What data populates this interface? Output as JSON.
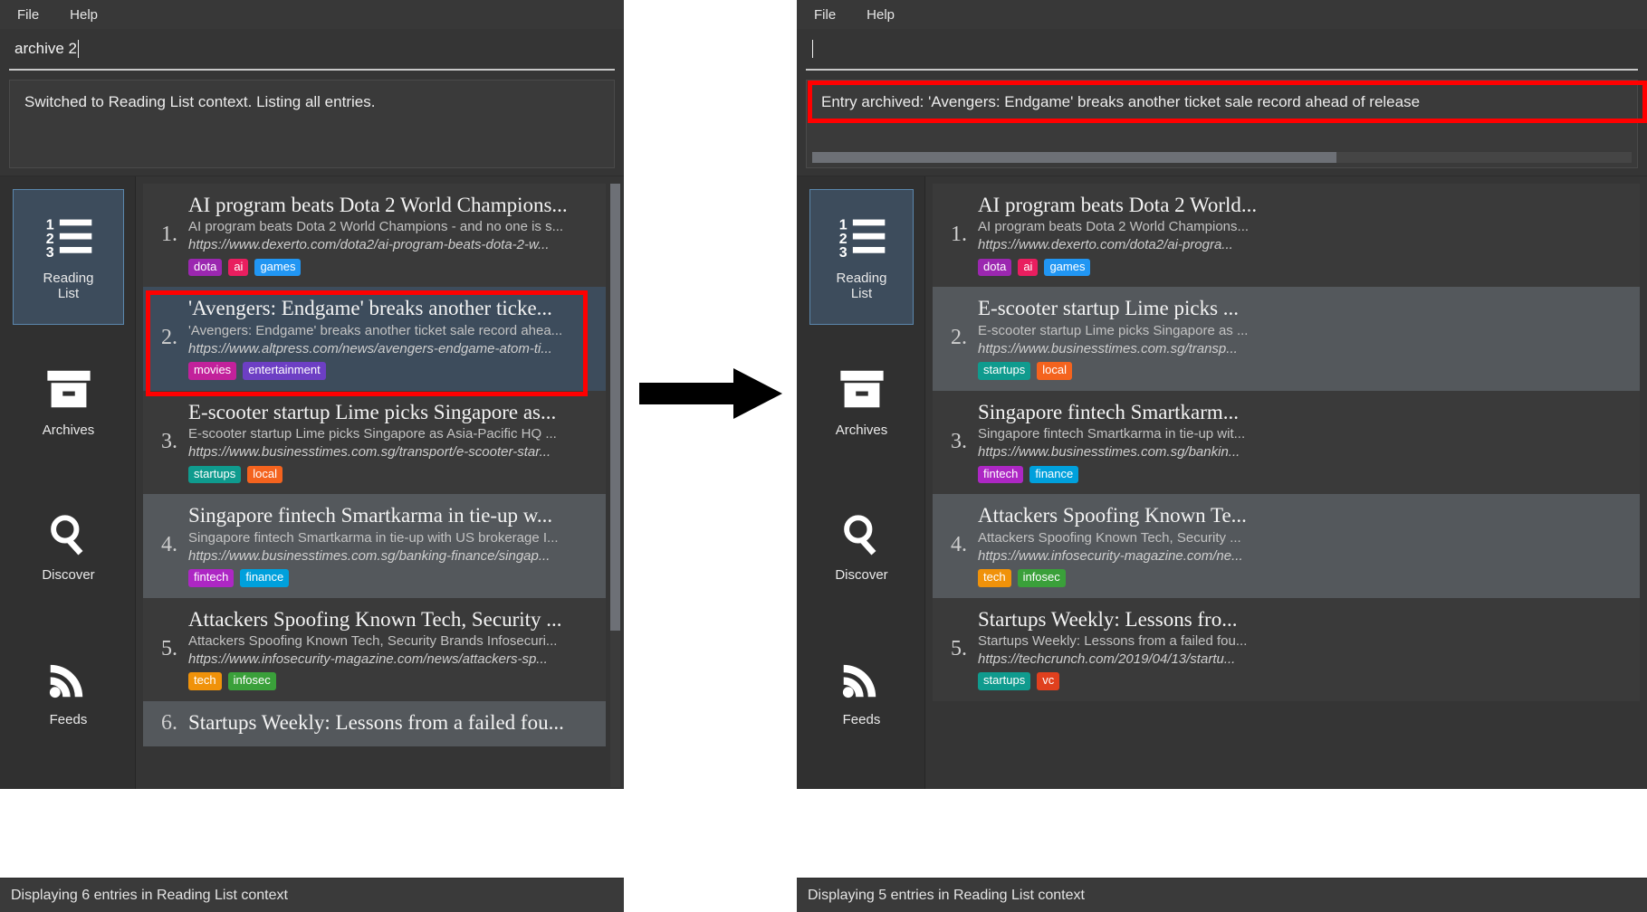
{
  "accent": {
    "highlight_red": "#ff0000",
    "selected_entry_bg": "#3d4c5c",
    "sidebar_active_border": "#5b87ad"
  },
  "menu": {
    "file": "File",
    "help": "Help"
  },
  "left": {
    "command_value": "archive 2",
    "output_message": "Switched to Reading List context. Listing all entries.",
    "status": "Displaying 6 entries in Reading List context",
    "sidebar": [
      {
        "label": "Reading\nList",
        "icon": "numbered-list-icon",
        "active": true
      },
      {
        "label": "Archives",
        "icon": "archive-box-icon",
        "active": false
      },
      {
        "label": "Discover",
        "icon": "magnifier-icon",
        "active": false
      },
      {
        "label": "Feeds",
        "icon": "rss-icon",
        "active": false
      }
    ],
    "entries": [
      {
        "num": "1.",
        "title": "AI program beats Dota 2 World Champions...",
        "desc": "AI program beats Dota 2 World Champions - and no one is s...",
        "url": "https://www.dexerto.com/dota2/ai-program-beats-dota-2-w...",
        "tags": [
          {
            "label": "dota",
            "color": "#9b27b0"
          },
          {
            "label": "ai",
            "color": "#e91e5f"
          },
          {
            "label": "games",
            "color": "#2196f3"
          }
        ],
        "selected": false,
        "alt": false
      },
      {
        "num": "2.",
        "title": "'Avengers: Endgame' breaks another ticke...",
        "desc": "'Avengers: Endgame' breaks another ticket sale record ahea...",
        "url": "https://www.altpress.com/news/avengers-endgame-atom-ti...",
        "tags": [
          {
            "label": "movies",
            "color": "#c2219b"
          },
          {
            "label": "entertainment",
            "color": "#6d3fc4"
          }
        ],
        "selected": true,
        "alt": false
      },
      {
        "num": "3.",
        "title": "E-scooter startup Lime picks Singapore as...",
        "desc": "E-scooter startup Lime picks Singapore as Asia-Pacific HQ ...",
        "url": "https://www.businesstimes.com.sg/transport/e-scooter-star...",
        "tags": [
          {
            "label": "startups",
            "color": "#0f9b8e"
          },
          {
            "label": "local",
            "color": "#f4631e"
          }
        ],
        "selected": false,
        "alt": false
      },
      {
        "num": "4.",
        "title": "Singapore fintech Smartkarma in tie-up w...",
        "desc": "Singapore fintech Smartkarma in tie-up with US brokerage I...",
        "url": "https://www.businesstimes.com.sg/banking-finance/singap...",
        "tags": [
          {
            "label": "fintech",
            "color": "#ad27c4"
          },
          {
            "label": "finance",
            "color": "#00a0dc"
          }
        ],
        "selected": false,
        "alt": true
      },
      {
        "num": "5.",
        "title": "Attackers Spoofing Known Tech, Security ...",
        "desc": "Attackers Spoofing Known Tech, Security Brands Infosecuri...",
        "url": "https://www.infosecurity-magazine.com/news/attackers-sp...",
        "tags": [
          {
            "label": "tech",
            "color": "#f0920a"
          },
          {
            "label": "infosec",
            "color": "#3aa03a"
          }
        ],
        "selected": false,
        "alt": false
      },
      {
        "num": "6.",
        "title": "Startups Weekly: Lessons from a failed fou...",
        "desc": "",
        "url": "",
        "tags": [],
        "selected": false,
        "alt": true
      }
    ]
  },
  "right": {
    "command_value": "",
    "output_message": "Entry archived: 'Avengers: Endgame' breaks another ticket sale record ahead of release",
    "status": "Displaying 5 entries in Reading List context",
    "sidebar": [
      {
        "label": "Reading\nList",
        "icon": "numbered-list-icon",
        "active": true
      },
      {
        "label": "Archives",
        "icon": "archive-box-icon",
        "active": false
      },
      {
        "label": "Discover",
        "icon": "magnifier-icon",
        "active": false
      },
      {
        "label": "Feeds",
        "icon": "rss-icon",
        "active": false
      }
    ],
    "entries": [
      {
        "num": "1.",
        "title": "AI program beats Dota 2 World...",
        "desc": "AI program beats Dota 2 World Champions...",
        "url": "https://www.dexerto.com/dota2/ai-progra...",
        "tags": [
          {
            "label": "dota",
            "color": "#9b27b0"
          },
          {
            "label": "ai",
            "color": "#e91e5f"
          },
          {
            "label": "games",
            "color": "#2196f3"
          }
        ],
        "selected": false,
        "alt": false
      },
      {
        "num": "2.",
        "title": "E-scooter startup Lime picks ...",
        "desc": "E-scooter startup Lime picks Singapore as ...",
        "url": "https://www.businesstimes.com.sg/transp...",
        "tags": [
          {
            "label": "startups",
            "color": "#0f9b8e"
          },
          {
            "label": "local",
            "color": "#f4631e"
          }
        ],
        "selected": false,
        "alt": true
      },
      {
        "num": "3.",
        "title": "Singapore fintech Smartkarm...",
        "desc": "Singapore fintech Smartkarma in tie-up wit...",
        "url": "https://www.businesstimes.com.sg/bankin...",
        "tags": [
          {
            "label": "fintech",
            "color": "#ad27c4"
          },
          {
            "label": "finance",
            "color": "#00a0dc"
          }
        ],
        "selected": false,
        "alt": false
      },
      {
        "num": "4.",
        "title": "Attackers Spoofing Known Te...",
        "desc": "Attackers Spoofing Known Tech, Security ...",
        "url": "https://www.infosecurity-magazine.com/ne...",
        "tags": [
          {
            "label": "tech",
            "color": "#f0920a"
          },
          {
            "label": "infosec",
            "color": "#3aa03a"
          }
        ],
        "selected": false,
        "alt": true
      },
      {
        "num": "5.",
        "title": "Startups Weekly: Lessons fro...",
        "desc": "Startups Weekly: Lessons from a failed fou...",
        "url": "https://techcrunch.com/2019/04/13/startu...",
        "tags": [
          {
            "label": "startups",
            "color": "#0f9b8e"
          },
          {
            "label": "vc",
            "color": "#e0401e"
          }
        ],
        "selected": false,
        "alt": false
      }
    ]
  },
  "arrow": {
    "name": "transition-arrow"
  }
}
